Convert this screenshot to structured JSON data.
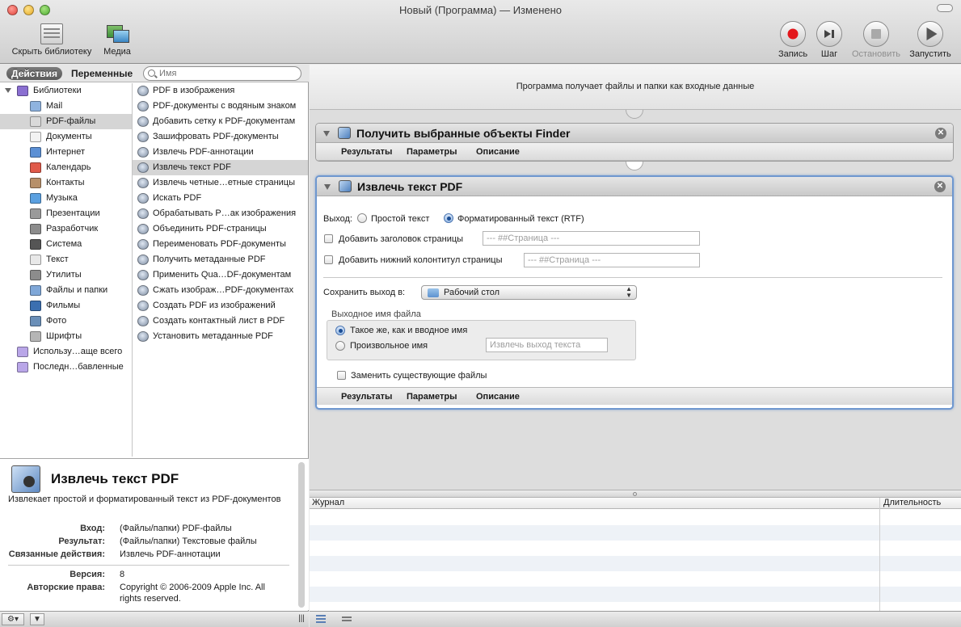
{
  "window": {
    "title": "Новый (Программа) — Изменено"
  },
  "toolbar": {
    "hide_library": "Скрыть библиотеку",
    "media": "Медиа",
    "record": "Запись",
    "step": "Шаг",
    "stop": "Остановить",
    "run": "Запустить"
  },
  "left": {
    "tab_actions": "Действия",
    "tab_variables": "Переменные",
    "search_placeholder": "Имя",
    "library": [
      {
        "label": "Библиотеки",
        "icon": "library-icon",
        "color": "#8a6fd1"
      },
      {
        "label": "Mail",
        "icon": "mail-icon",
        "color": "#8fb3df"
      },
      {
        "label": "PDF-файлы",
        "icon": "pdf-icon",
        "color": "#d9d9d9"
      },
      {
        "label": "Документы",
        "icon": "document-icon",
        "color": "#f2f2f2"
      },
      {
        "label": "Интернет",
        "icon": "globe-icon",
        "color": "#5b8fd4"
      },
      {
        "label": "Календарь",
        "icon": "calendar-icon",
        "color": "#e05a4a"
      },
      {
        "label": "Контакты",
        "icon": "contacts-icon",
        "color": "#b7906a"
      },
      {
        "label": "Музыка",
        "icon": "music-icon",
        "color": "#5aa0e0"
      },
      {
        "label": "Презентации",
        "icon": "presentation-icon",
        "color": "#9a9a9a"
      },
      {
        "label": "Разработчик",
        "icon": "developer-icon",
        "color": "#8c8c8c"
      },
      {
        "label": "Система",
        "icon": "system-icon",
        "color": "#555555"
      },
      {
        "label": "Текст",
        "icon": "text-icon",
        "color": "#e8e8e8"
      },
      {
        "label": "Утилиты",
        "icon": "utilities-icon",
        "color": "#8c8c8c"
      },
      {
        "label": "Файлы и папки",
        "icon": "folder-icon",
        "color": "#7fa7d8"
      },
      {
        "label": "Фильмы",
        "icon": "movie-icon",
        "color": "#3b6fb0"
      },
      {
        "label": "Фото",
        "icon": "photo-icon",
        "color": "#6a8fb8"
      },
      {
        "label": "Шрифты",
        "icon": "fonts-icon",
        "color": "#b5b5b5"
      },
      {
        "label": "Использу…аще всего",
        "icon": "smart-folder-icon",
        "color": "#b9a6e8"
      },
      {
        "label": "Последн…бавленные",
        "icon": "smart-folder-icon",
        "color": "#b9a6e8"
      }
    ],
    "actions": [
      "PDF в изображения",
      "PDF-документы с водяным знаком",
      "Добавить сетку к PDF-документам",
      "Зашифровать PDF-документы",
      "Извлечь PDF-аннотации",
      "Извлечь текст PDF",
      "Извлечь четные…етные страницы",
      "Искать PDF",
      "Обрабатывать Р…ак изображения",
      "Объединить PDF-страницы",
      "Переименовать PDF-документы",
      "Получить метаданные PDF",
      "Применить Qua…DF-документам",
      "Сжать изображ…PDF-документах",
      "Создать PDF из изображений",
      "Создать контактный лист в PDF",
      "Установить метаданные PDF"
    ],
    "info": {
      "title": "Извлечь текст PDF",
      "description": "Извлекает простой и форматированный текст из PDF-документов",
      "input_label": "Вход:",
      "input_value": "(Файлы/папки) PDF-файлы",
      "result_label": "Результат:",
      "result_value": "(Файлы/папки) Текстовые файлы",
      "related_label": "Связанные действия:",
      "related_value": "Извлечь PDF-аннотации",
      "version_label": "Версия:",
      "version_value": "8",
      "copyright_label": "Авторские права:",
      "copyright_value_1": "Copyright © 2006-2009 Apple Inc. All",
      "copyright_value_2": "rights reserved."
    }
  },
  "workflow": {
    "header": "Программа получает файлы и папки как входные данные",
    "tabs": {
      "results": "Результаты",
      "options": "Параметры",
      "description": "Описание"
    },
    "action1": {
      "title": "Получить выбранные объекты Finder"
    },
    "action2": {
      "title": "Извлечь текст PDF",
      "output_label": "Выход:",
      "plain_text": "Простой текст",
      "rich_text": "Форматированный текст (RTF)",
      "add_header": "Добавить заголовок страницы",
      "header_placeholder": "--- ##Страница ---",
      "add_footer": "Добавить нижний колонтитул страницы",
      "footer_placeholder": "--- ##Страница ---",
      "save_output_label": "Сохранить выход в:",
      "save_location": "Рабочий стол",
      "output_filename_label": "Выходное имя файла",
      "same_as_input": "Такое же, как и вводное имя",
      "custom_name": "Произвольное имя",
      "custom_name_placeholder": "Извлечь выход текста",
      "replace_existing": "Заменить существующие файлы"
    }
  },
  "log": {
    "col_journal": "Журнал",
    "col_duration": "Длительность"
  },
  "colors": {
    "record_red": "#e3161b",
    "focus_blue": "#6e97cf"
  }
}
